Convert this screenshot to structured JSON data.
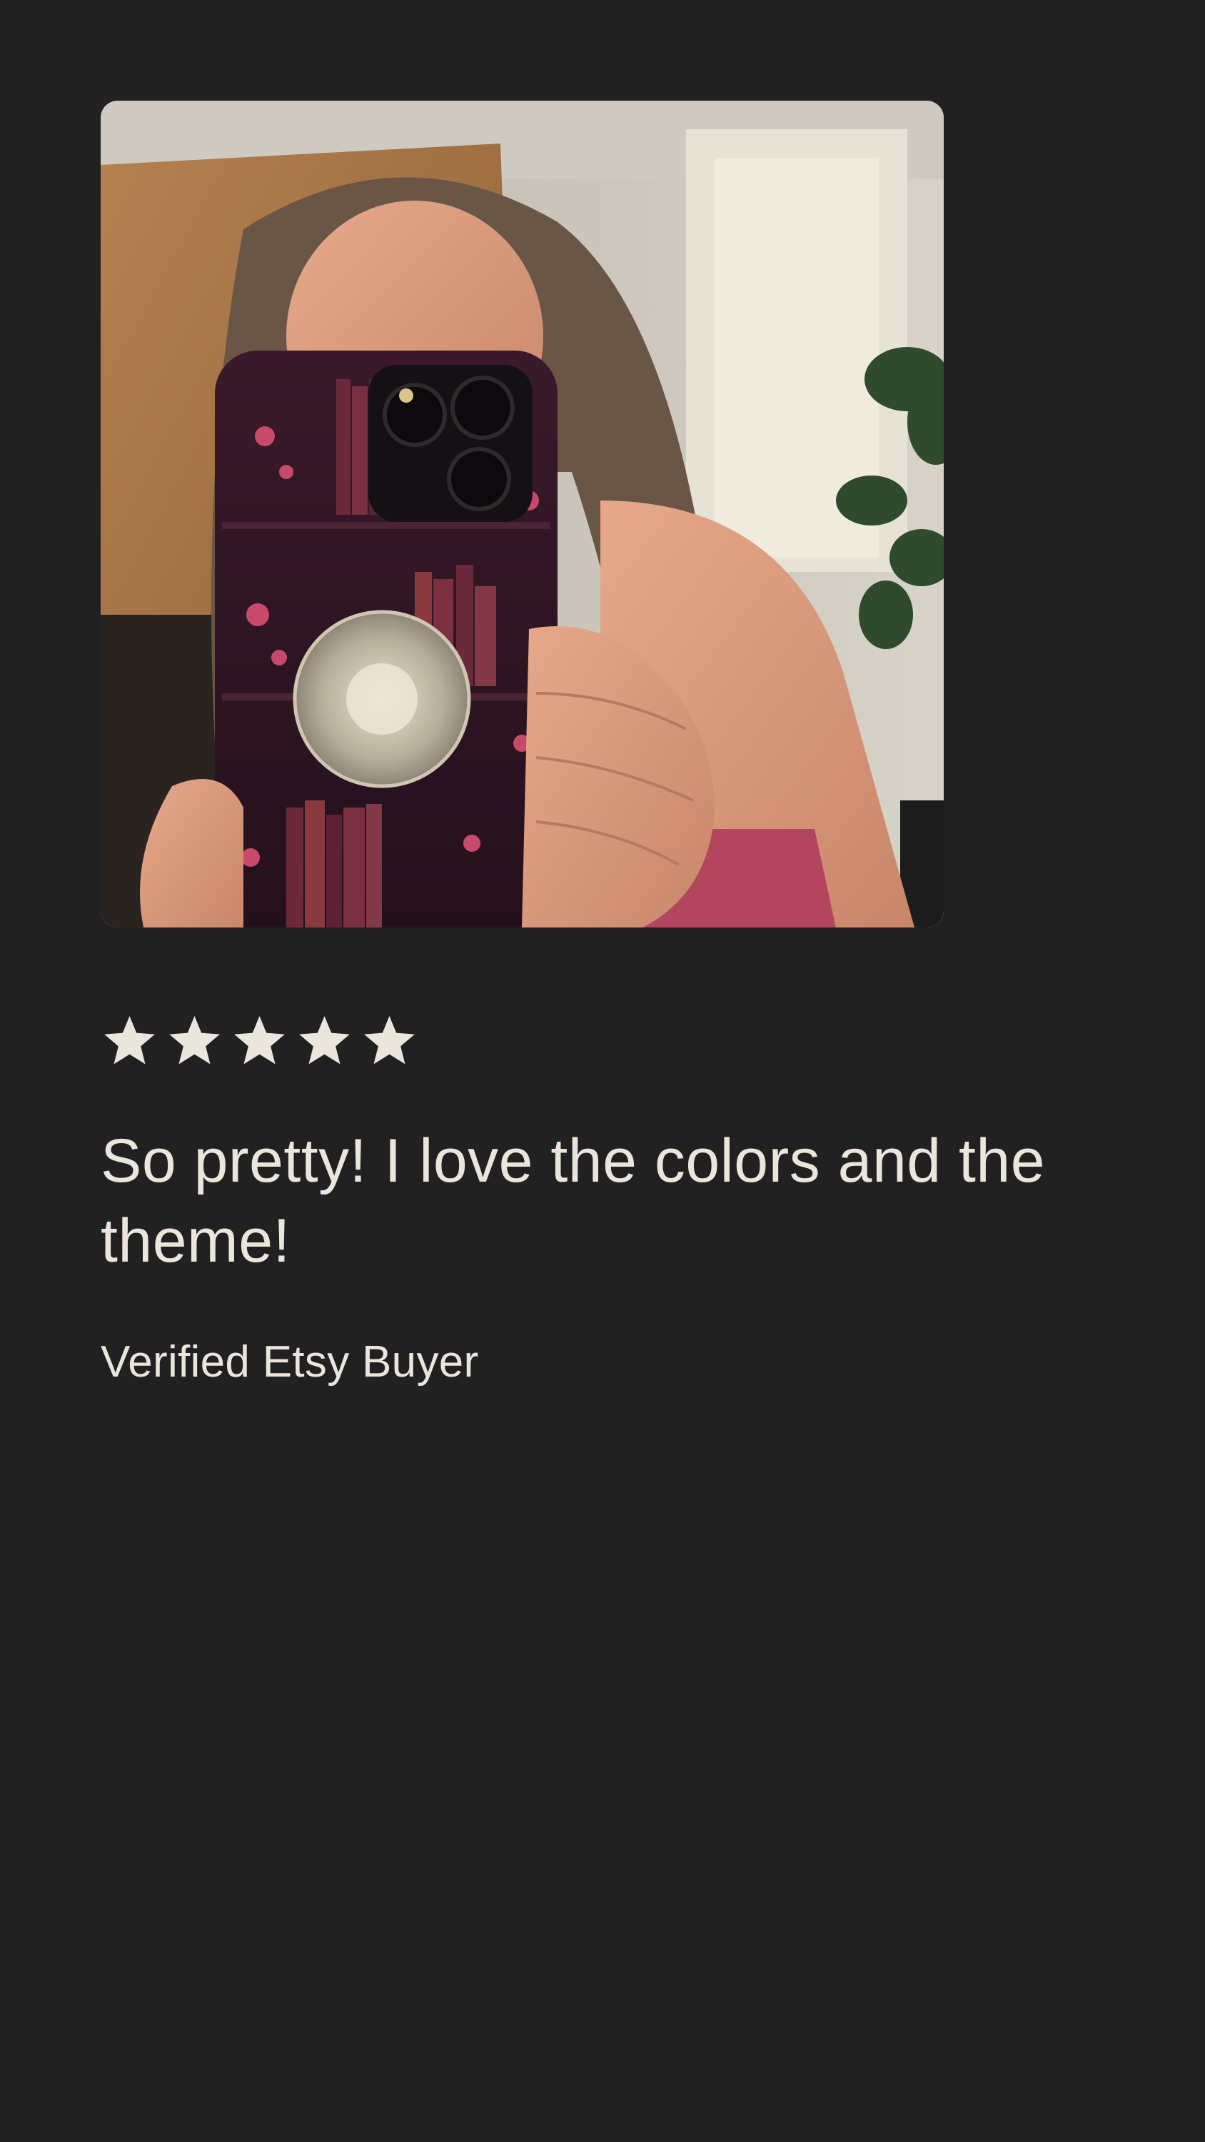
{
  "review": {
    "photo_subject": "mirror-selfie-phone-case-bookshelf-design",
    "rating": {
      "value": 5,
      "max": 5,
      "icon": "star-icon",
      "color": "#ebe6dc"
    },
    "text": "So pretty! I love the colors and the theme!",
    "reviewer": "Verified Etsy Buyer"
  },
  "colors": {
    "background": "#212121",
    "text": "#ebe6dc"
  }
}
